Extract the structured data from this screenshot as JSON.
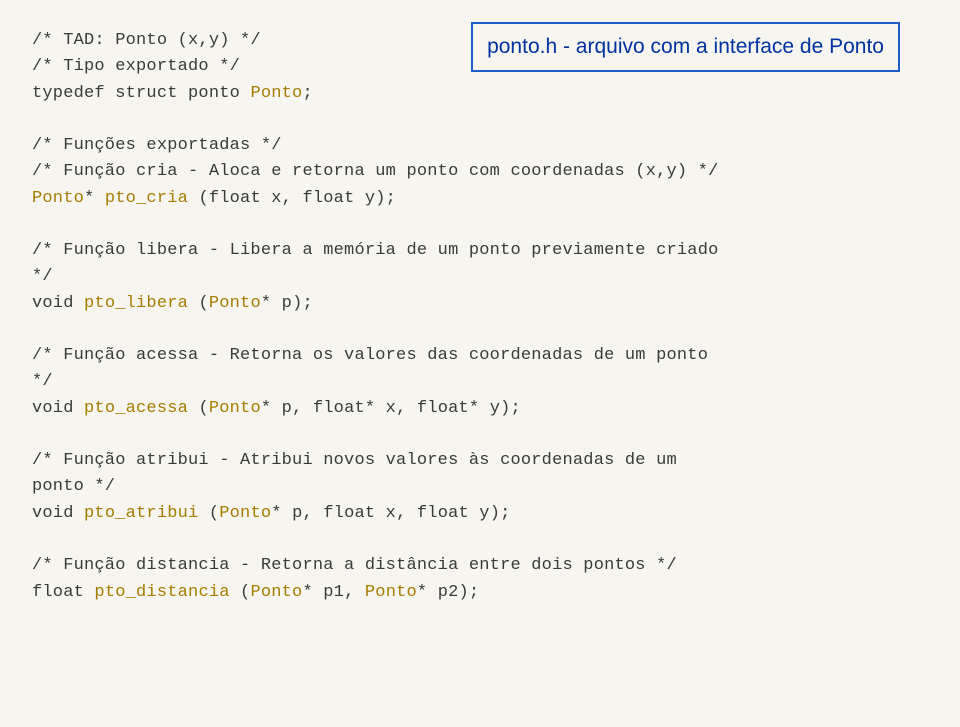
{
  "callout": "ponto.h - arquivo com a interface de Ponto",
  "p1": {
    "l1": "/* TAD: Ponto (x,y) */",
    "l2": "/* Tipo exportado */",
    "l3a": "typedef struct ponto ",
    "l3b": "Ponto",
    "l3c": ";"
  },
  "p2": {
    "l1": "/* Funções exportadas */",
    "l2": "/* Função cria - Aloca e retorna um ponto com coordenadas (x,y) */",
    "l3a": "Ponto",
    "l3b": "* ",
    "l3c": "pto_cria ",
    "l3d": "(float x, float y);"
  },
  "p3": {
    "l1": "/* Função libera - Libera a memória de um ponto previamente criado",
    "l2": "*/",
    "l3a": "void ",
    "l3b": "pto_libera ",
    "l3c": "(",
    "l3d": "Ponto",
    "l3e": "* p);"
  },
  "p4": {
    "l1": "/* Função acessa - Retorna os valores das coordenadas de um ponto",
    "l2": "*/",
    "l3a": "void ",
    "l3b": "pto_acessa ",
    "l3c": "(",
    "l3d": "Ponto",
    "l3e": "* p, float* x, float* y);"
  },
  "p5": {
    "l1": "/* Função atribui - Atribui novos valores às coordenadas de um",
    "l2": "ponto */",
    "l3a": "void ",
    "l3b": "pto_atribui ",
    "l3c": "(",
    "l3d": "Ponto",
    "l3e": "* p, float x, float y);"
  },
  "p6": {
    "l1": "/* Função distancia - Retorna a distância entre dois pontos */",
    "l2a": "float ",
    "l2b": "pto_distancia ",
    "l2c": "(",
    "l2d": "Ponto",
    "l2e": "* p1, ",
    "l2f": "Ponto",
    "l2g": "* p2);"
  }
}
